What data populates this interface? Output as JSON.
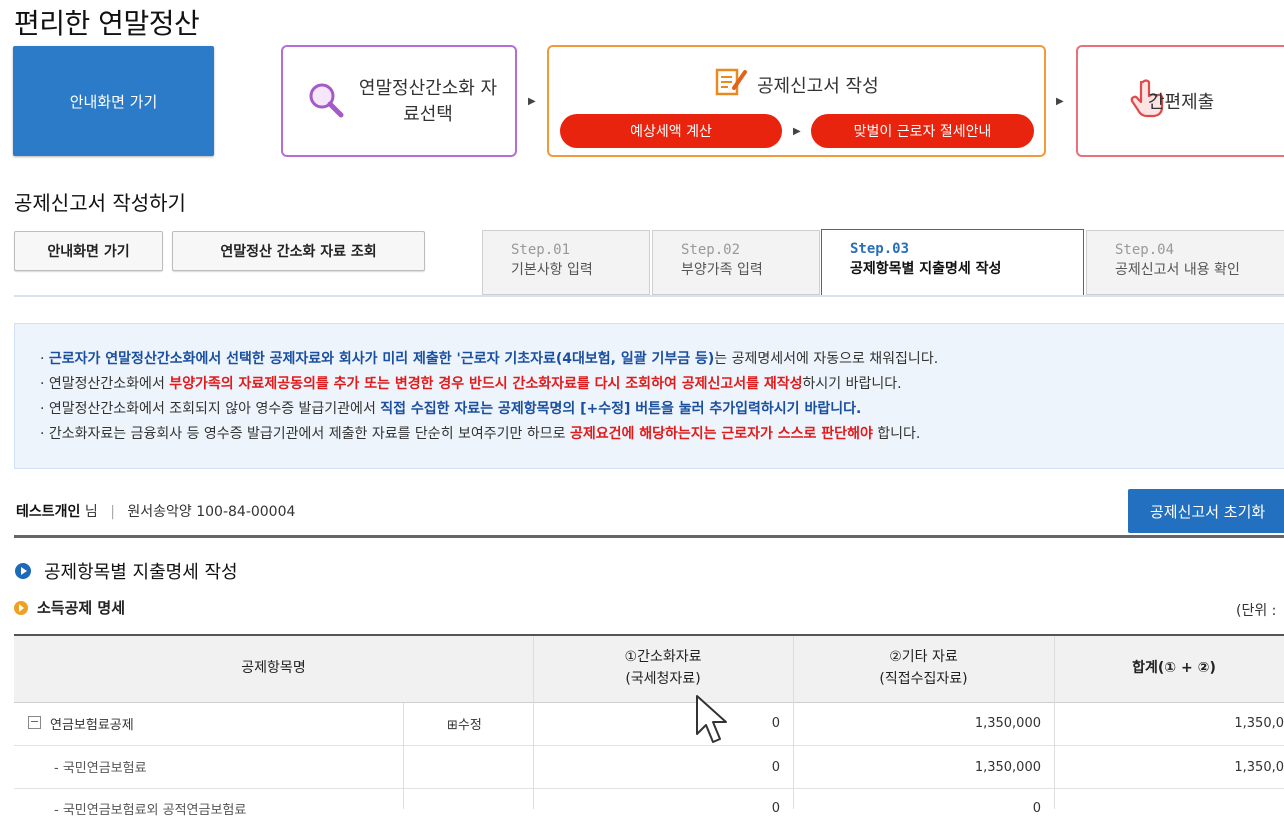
{
  "page_title": "편리한 연말정산",
  "flow": {
    "guide_button": "안내화면 가기",
    "step1": "연말정산간소화 자료선택",
    "step2_title": "공제신고서 작성",
    "step2_pill1": "예상세액 계산",
    "step2_pill2": "맞벌이 근로자 절세안내",
    "step3": "간편제출"
  },
  "section_title": "공제신고서 작성하기",
  "buttons": {
    "guide": "안내화면 가기",
    "lookup": "연말정산 간소화 자료 조회"
  },
  "steps": [
    {
      "num": "Step.01",
      "name": "기본사항 입력"
    },
    {
      "num": "Step.02",
      "name": "부양가족 입력"
    },
    {
      "num": "Step.03",
      "name": "공제항목별 지출명세 작성"
    },
    {
      "num": "Step.04",
      "name": "공제신고서 내용 확인"
    }
  ],
  "notice": {
    "l1_a": "· ",
    "l1_b": "근로자가 연말정산간소화에서 선택한 공제자료와 회사가 미리 제출한 '근로자 기초자료(4대보험, 일괄 기부금 등)",
    "l1_c": "는 공제명세서에 자동으로 채워집니다.",
    "l2_a": "· 연말정산간소화에서 ",
    "l2_b": "부양가족의 자료제공동의를 추가 또는 변경한 경우 반드시 간소화자료를 다시 조회하여 공제신고서를 재작성",
    "l2_c": "하시기 바랍니다.",
    "l3_a": "· 연말정산간소화에서 조회되지 않아 영수증 발급기관에서 ",
    "l3_b": "직접 수집한 자료는 공제항목명의 [+수정] 버튼을 눌러 추가입력하시기 바랍니다.",
    "l4_a": "· 간소화자료는 금융회사 등 영수증 발급기관에서 제출한 자료를 단순히 보여주기만 하므로 ",
    "l4_b": "공제요건에 해당하는지는 근로자가 스스로 판단해야",
    "l4_c": " 합니다."
  },
  "user": {
    "name": "테스트개인",
    "honorific": " 님",
    "sep": "|",
    "company": "원서송악양 100-84-00004"
  },
  "reset_button": "공제신고서 초기화",
  "subsection_title": "공제항목별 지출명세 작성",
  "income_title": "소득공제 명세",
  "unit_label": "(단위 :",
  "table": {
    "col_name": "공제항목명",
    "col1_l1": "①간소화자료",
    "col1_l2": "(국세청자료)",
    "col2_l1": "②기타 자료",
    "col2_l2": "(직접수집자료)",
    "col3": "합계(① + ②)",
    "edit_label": "⊞수정",
    "rows": [
      {
        "name": "연금보험료공제",
        "v1": "0",
        "v2": "1,350,000",
        "v3": "1,350,0"
      },
      {
        "name": "- 국민연금보험료",
        "v1": "0",
        "v2": "1,350,000",
        "v3": "1,350,0"
      },
      {
        "name": "- 국민연금보험료외 공적연금보험료",
        "v1": "0",
        "v2": "0",
        "v3": ""
      }
    ]
  }
}
